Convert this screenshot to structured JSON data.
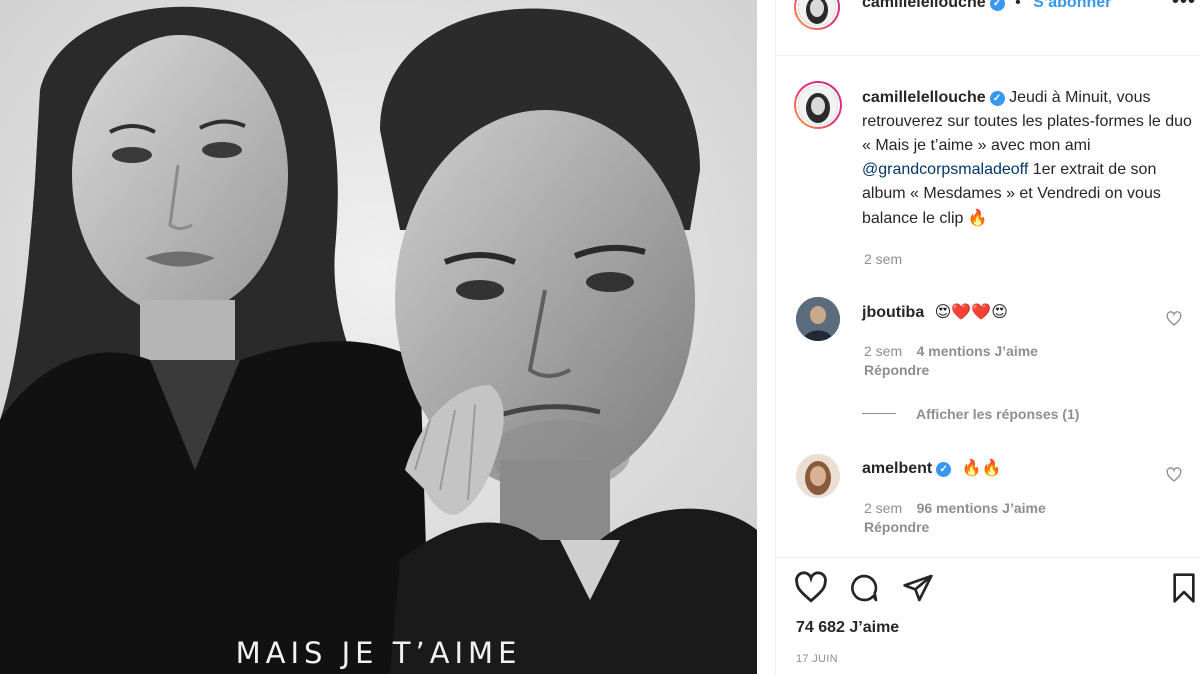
{
  "photo": {
    "title": "MAIS JE T’AIME"
  },
  "post_header": {
    "username": "camillelellouche",
    "follow_label": "S’abonner",
    "more_label": "•••"
  },
  "caption": {
    "username": "camillelellouche",
    "text_1": "Jeudi à Minuit, vous retrouverez sur toutes les plates-formes le duo « Mais je t’aime » avec mon ami ",
    "mention": "@grandcorpsmaladeoff",
    "text_2": " 1er extrait de son album « Mesdames » et Vendredi on vous balance le clip ",
    "emoji": "🔥",
    "time": "2 sem"
  },
  "comments": [
    {
      "username": "jboutiba",
      "text": "😍❤️❤️😍",
      "time": "2 sem",
      "likes": "4 mentions J’aime",
      "reply": "Répondre"
    },
    {
      "username": "amelbent",
      "text": "🔥🔥",
      "time": "2 sem",
      "likes": "96 mentions J’aime",
      "reply": "Répondre"
    }
  ],
  "view_replies": "Afficher les réponses (1)",
  "likes_count": "74 682 J’aime",
  "date": "17 JUIN",
  "colors": {
    "accent": "#3897f0",
    "mention": "#00376b",
    "muted": "#8e8e8e",
    "text": "#262626"
  },
  "icons": [
    "heart-icon",
    "comment-icon",
    "share-icon",
    "bookmark-icon",
    "verified-icon",
    "more-icon"
  ]
}
